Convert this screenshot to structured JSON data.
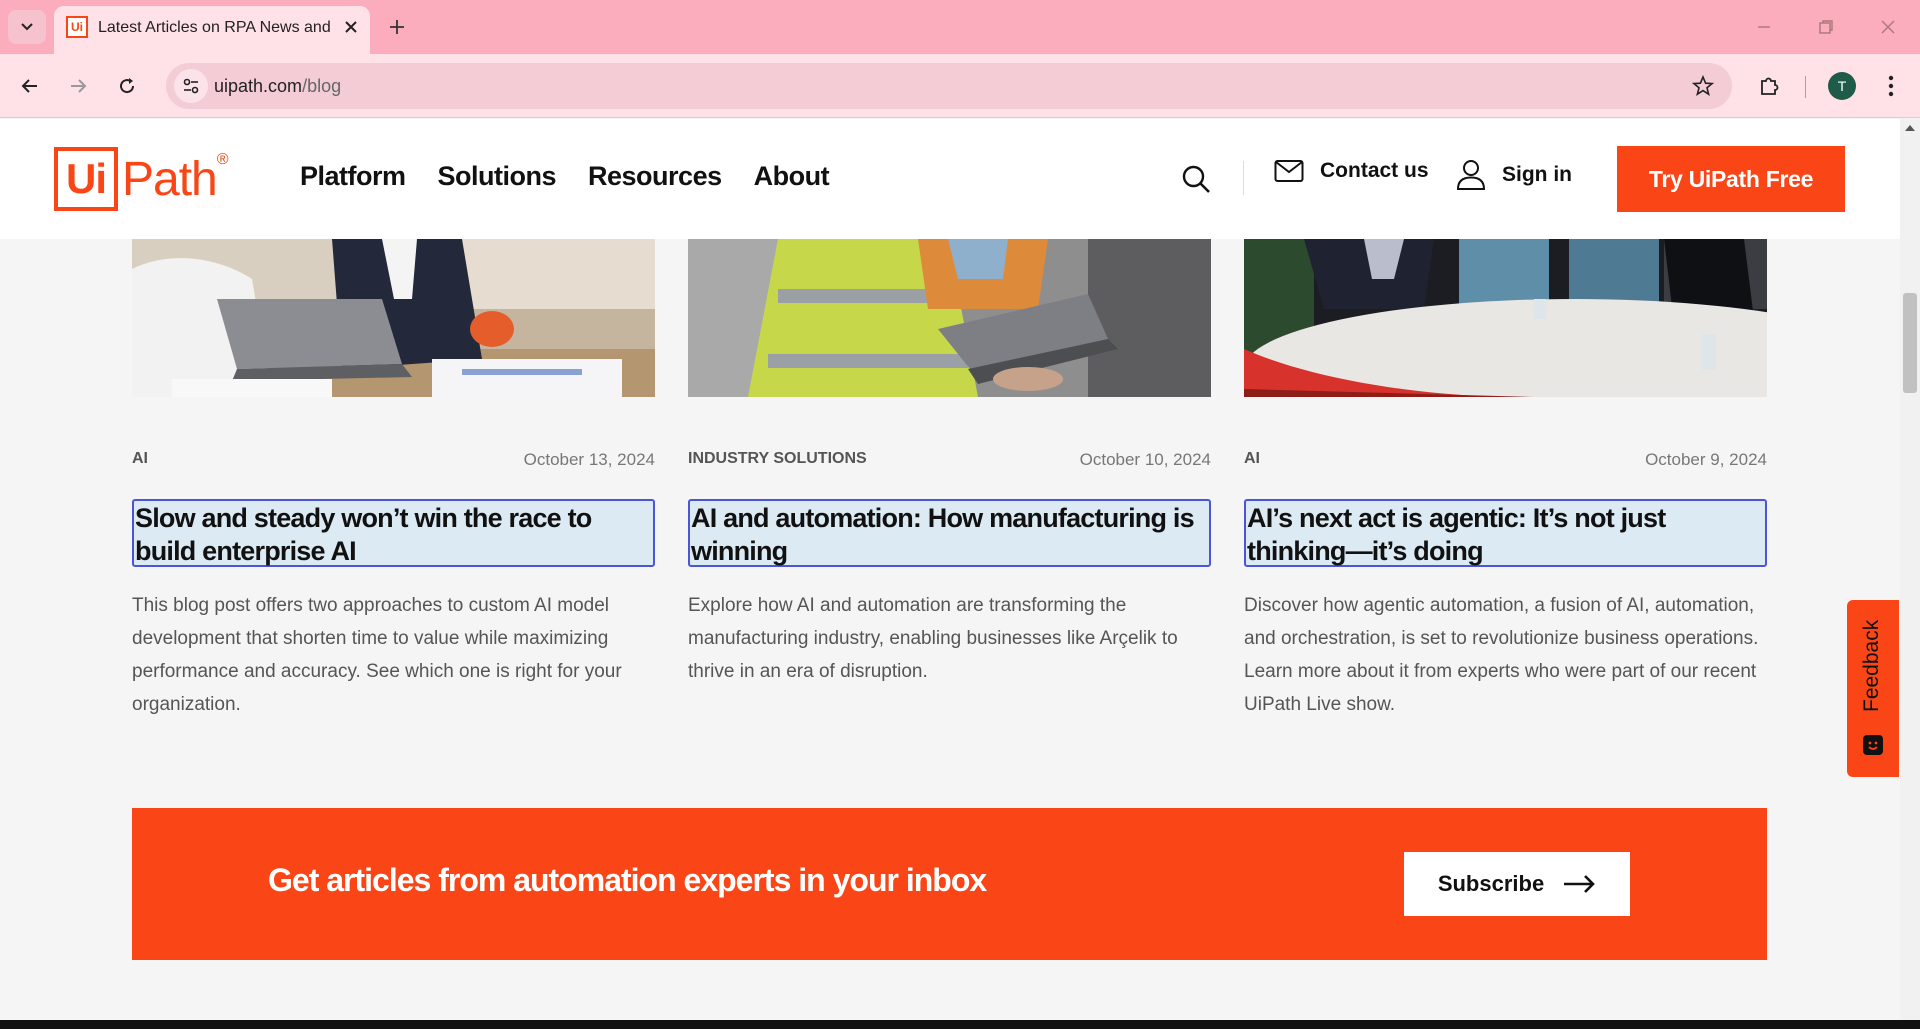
{
  "browser": {
    "tab_title": "Latest Articles on RPA News and",
    "url_domain": "uipath.com",
    "url_path": "/blog",
    "profile_initial": "T"
  },
  "header": {
    "logo_box": "Ui",
    "logo_rest": "Path",
    "logo_reg": "®",
    "nav": [
      "Platform",
      "Solutions",
      "Resources",
      "About"
    ],
    "contact_label": "Contact us",
    "signin_label": "Sign in",
    "cta_label": "Try UiPath Free"
  },
  "cards": [
    {
      "category": "AI",
      "date": "October 13, 2024",
      "title": "Slow and steady won’t win the race to build enterprise AI",
      "description": "This blog post offers two approaches to custom AI model development that shorten time to value while maximizing performance and accuracy. See which one is right for your organization."
    },
    {
      "category": "INDUSTRY SOLUTIONS",
      "date": "October 10, 2024",
      "title": "AI and automation: How manufacturing is winning",
      "description": "Explore how AI and automation are transforming the manufacturing industry, enabling businesses like Arçelik to thrive in an era of disruption."
    },
    {
      "category": "AI",
      "date": "October 9, 2024",
      "title": "AI’s next act is agentic: It’s not just thinking—it’s doing",
      "description": "Discover how agentic automation, a fusion of AI, automation, and orchestration, is set to revolutionize business operations. Learn more about it from experts who were part of our recent UiPath Live show."
    }
  ],
  "subscribe": {
    "heading": "Get articles from automation experts in your inbox",
    "button_label": "Subscribe"
  },
  "feedback": {
    "label": "Feedback"
  },
  "colors": {
    "brand": "#fa4616",
    "title_highlight": "#dceaf4",
    "title_outline": "#4a55d8",
    "tabbar": "#fcadbd"
  }
}
